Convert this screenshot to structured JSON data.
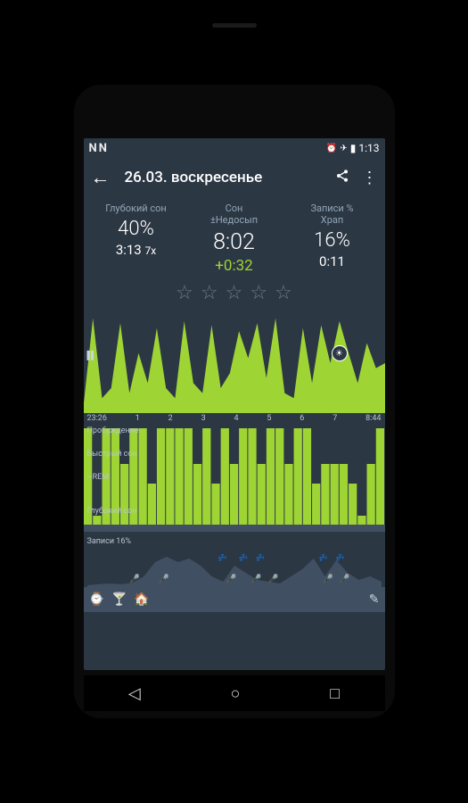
{
  "status": {
    "time": "1:13",
    "n1": "N",
    "n2": "N",
    "alarm": "⏰",
    "plane": "✈",
    "battery": "▮"
  },
  "appbar": {
    "title": "26.03. воскресенье"
  },
  "stats": {
    "deep": {
      "label": "Глубокий сон",
      "value": "40%",
      "sub": "3:13",
      "times": "7x"
    },
    "sleep": {
      "label": "Сон\n±Недосып",
      "value": "8:02",
      "diff": "+0:32"
    },
    "snore": {
      "label": "Записи %\nХрап",
      "value": "16%",
      "sub": "0:11"
    }
  },
  "time_axis": [
    "23:26",
    "1",
    "2",
    "3",
    "4",
    "5",
    "6",
    "7",
    "8:44"
  ],
  "hypno": {
    "l1": "Пробуждение",
    "l2": "Быстрый сон",
    "l3": "~REM",
    "l4": "Глубокий сон"
  },
  "snore_label": "Записи 16%",
  "chart_data": {
    "actigraph": {
      "type": "area",
      "x_range": [
        "23:26",
        "8:44"
      ],
      "ylim": [
        0,
        100
      ],
      "values": [
        10,
        95,
        15,
        25,
        90,
        20,
        60,
        30,
        85,
        25,
        15,
        92,
        30,
        20,
        88,
        25,
        40,
        82,
        55,
        90,
        35,
        95,
        20,
        15,
        85,
        30,
        88,
        50,
        92,
        60,
        30,
        70,
        45,
        50
      ]
    },
    "hypnogram": {
      "type": "bar",
      "stages": [
        "Пробуждение",
        "Быстрый сон",
        "~REM",
        "Глубокий сон"
      ],
      "timeline": [
        3,
        0,
        3,
        3,
        2,
        3,
        3,
        1,
        3,
        3,
        3,
        3,
        2,
        3,
        1,
        3,
        2,
        3,
        3,
        2,
        3,
        3,
        2,
        3,
        3,
        1,
        2,
        2,
        2,
        1,
        0,
        2,
        3
      ]
    },
    "snore": {
      "type": "area",
      "x_range": [
        "23:26",
        "8:44"
      ],
      "values": [
        5,
        8,
        10,
        8,
        12,
        30,
        70,
        85,
        70,
        80,
        60,
        30,
        15,
        60,
        40,
        20,
        15,
        10,
        30,
        50,
        80,
        30,
        75,
        40,
        20,
        30,
        15
      ]
    }
  }
}
